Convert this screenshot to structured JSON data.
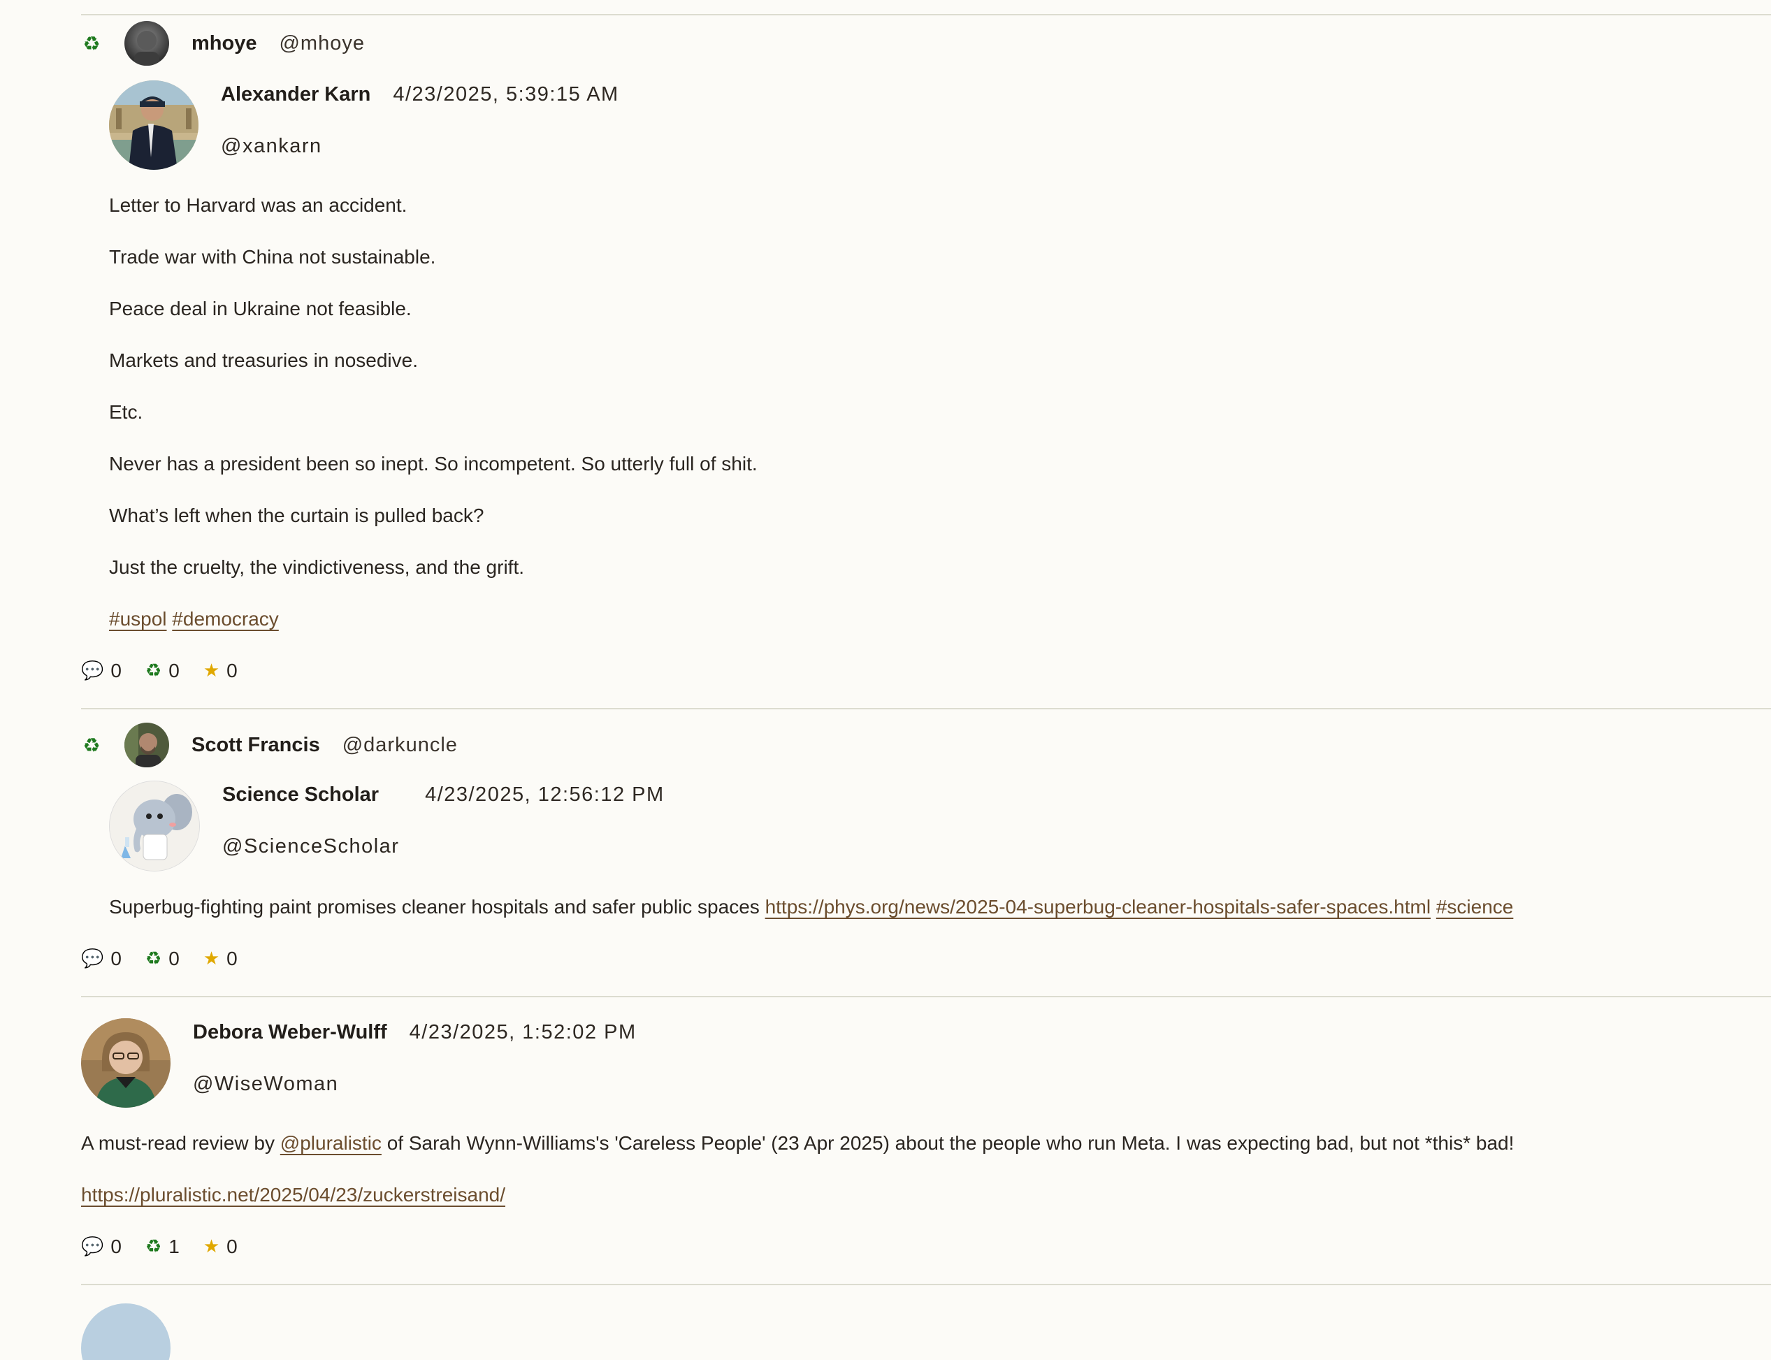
{
  "posts": [
    {
      "boosted_by": {
        "name": "mhoye",
        "handle": "@mhoye"
      },
      "author": {
        "name": "Alexander Karn",
        "handle": "@xankarn"
      },
      "date": "4/23/2025, 5:39:15 AM",
      "paragraphs": [
        "Letter to Harvard was an accident.",
        "Trade war with China not sustainable.",
        "Peace deal in Ukraine not feasible.",
        "Markets and treasuries in nosedive.",
        "Etc.",
        "Never has a president been so inept. So incompetent. So utterly full of shit.",
        "What’s left when the curtain is pulled back?",
        "Just the cruelty, the vindictiveness, and the grift."
      ],
      "tags": [
        "#uspol",
        "#democracy"
      ],
      "counts": {
        "replies": "0",
        "boosts": "0",
        "favourites": "0"
      }
    },
    {
      "boosted_by": {
        "name": "Scott Francis",
        "handle": "@darkuncle"
      },
      "author": {
        "name": "Science Scholar",
        "handle": "@ScienceScholar"
      },
      "date": "4/23/2025, 12:56:12 PM",
      "text": "Superbug-fighting paint promises cleaner hospitals and safer public spaces",
      "link": "https://phys.org/news/2025-04-superbug-cleaner-hospitals-safer-spaces.html",
      "tag": "#science",
      "counts": {
        "replies": "0",
        "boosts": "0",
        "favourites": "0"
      }
    },
    {
      "author": {
        "name": "Debora Weber-Wulff",
        "handle": "@WiseWoman"
      },
      "date": "4/23/2025, 1:52:02 PM",
      "text_before": "A must-read review by",
      "mention": "@pluralistic",
      "text_after": "of Sarah Wynn-Williams's 'Careless People' (23 Apr 2025) about the people who run Meta. I was expecting bad, but not *this* bad!",
      "link": "https://pluralistic.net/2025/04/23/zuckerstreisand/",
      "counts": {
        "replies": "0",
        "boosts": "1",
        "favourites": "0"
      }
    }
  ],
  "icons": {
    "boost": "recycle-icon",
    "reply": "speech-bubble-icon",
    "favourite": "star-icon"
  },
  "colors": {
    "background": "#fcfbf7",
    "link": "#6b4d2e",
    "boost": "#1f7a1f",
    "star": "#e0a800",
    "divider": "#dcdcd0"
  }
}
